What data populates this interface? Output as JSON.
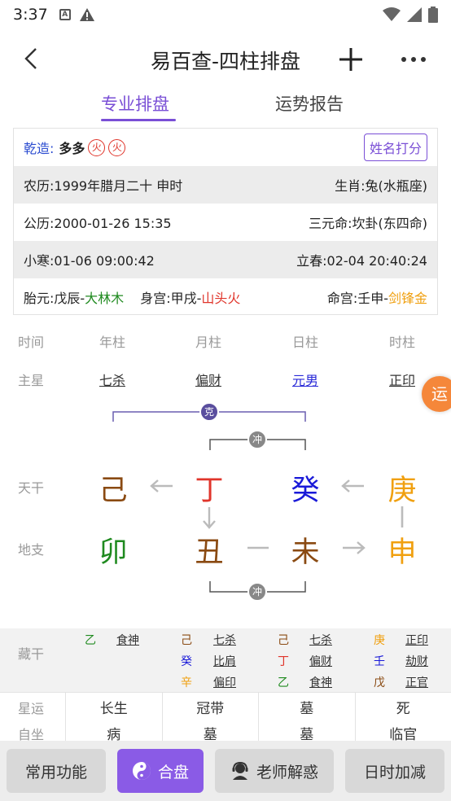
{
  "status": {
    "time": "3:37"
  },
  "appbar": {
    "title": "易百查-四柱排盘"
  },
  "tabs": {
    "pro": "专业排盘",
    "report": "运势报告"
  },
  "info": {
    "gender_label": "乾造:",
    "name": "多多",
    "badge1": "火",
    "badge2": "火",
    "score_button": "姓名打分",
    "lunar": "农历:1999年腊月二十 申时",
    "zodiac": "生肖:兔(水瓶座)",
    "solar": "公历:2000-01-26 15:35",
    "sanyuan": "三元命:坎卦(东四命)",
    "xiaohan": "小寒:01-06 09:00:42",
    "lichun": "立春:02-04 20:40:24",
    "taiyuan_prefix": "胎元:戊辰-",
    "taiyuan_value": "大林木",
    "shengong_prefix": "身宫:甲戌-",
    "shengong_value": "山头火",
    "minggong_prefix": "命宫:壬申-",
    "minggong_value": "剑锋金"
  },
  "grid": {
    "time_label": "时间",
    "columns": [
      "年柱",
      "月柱",
      "日柱",
      "时柱"
    ],
    "main_star_label": "主星",
    "main_stars": [
      "七杀",
      "偏财",
      "元男",
      "正印"
    ],
    "tiangan_label": "天干",
    "tiangan": [
      "己",
      "丁",
      "癸",
      "庚"
    ],
    "dizhi_label": "地支",
    "dizhi": [
      "卯",
      "丑",
      "未",
      "申"
    ],
    "ke_label": "克",
    "chong_label": "冲",
    "yun_button": "运"
  },
  "hidden_stems": {
    "label": "藏干",
    "columns": [
      [
        {
          "stem": "乙",
          "god": "食神"
        }
      ],
      [
        {
          "stem": "己",
          "god": "七杀"
        },
        {
          "stem": "癸",
          "god": "比肩"
        },
        {
          "stem": "辛",
          "god": "偏印"
        }
      ],
      [
        {
          "stem": "己",
          "god": "七杀"
        },
        {
          "stem": "丁",
          "god": "偏财"
        },
        {
          "stem": "乙",
          "god": "食神"
        }
      ],
      [
        {
          "stem": "庚",
          "god": "正印"
        },
        {
          "stem": "壬",
          "god": "劫财"
        },
        {
          "stem": "戊",
          "god": "正官"
        }
      ]
    ]
  },
  "xingyun": {
    "label": "星运",
    "values": [
      "长生",
      "冠带",
      "墓",
      "死"
    ]
  },
  "zizuo": {
    "label": "自坐",
    "values": [
      "病",
      "墓",
      "墓",
      "临官"
    ]
  },
  "bottom": {
    "common": "常用功能",
    "hepan": "合盘",
    "teacher": "老师解惑",
    "adjust": "日时加减"
  },
  "colors": {
    "accent": "#7a4fd6",
    "orange": "#f5873a",
    "red": "#e0352b",
    "green": "#1f8a1f",
    "blue": "#1a1ad8",
    "gold": "#f0a010",
    "brown": "#8a4a12"
  }
}
